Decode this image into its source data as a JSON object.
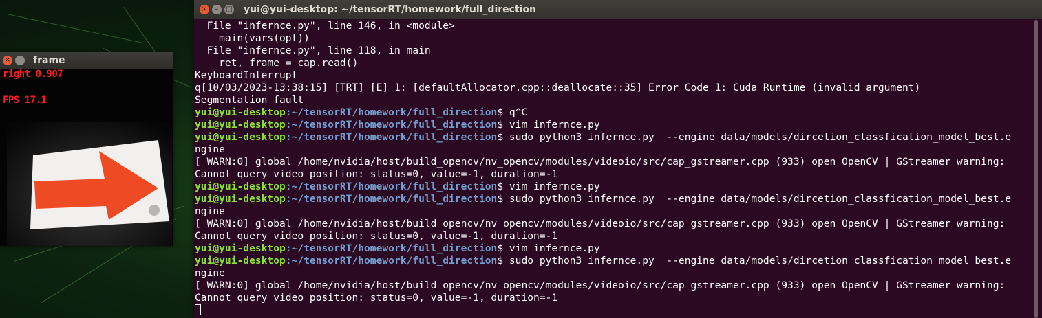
{
  "frame_window": {
    "title": "frame",
    "close_glyph": "×",
    "min_glyph": "–",
    "overlay_label": "right 0.907",
    "overlay_fps": "FPS 17.1",
    "arrow_color": "#ee4a24",
    "card_color": "#f2f0ee"
  },
  "terminal": {
    "title": "yui@yui-desktop: ~/tensorRT/homework/full_direction",
    "close_glyph": "×",
    "min_glyph": "–",
    "max_glyph": "□",
    "prompt_user": "yui@yui-desktop",
    "prompt_path": ":~/tensorRT/homework/full_direction",
    "lines": [
      {
        "type": "out",
        "text": "  File \"infernce.py\", line 146, in <module>"
      },
      {
        "type": "out",
        "text": "    main(vars(opt))"
      },
      {
        "type": "out",
        "text": "  File \"infernce.py\", line 118, in main"
      },
      {
        "type": "out",
        "text": "    ret, frame = cap.read()"
      },
      {
        "type": "out",
        "text": "KeyboardInterrupt"
      },
      {
        "type": "out",
        "text": "q[10/03/2023-13:38:15] [TRT] [E] 1: [defaultAllocator.cpp::deallocate::35] Error Code 1: Cuda Runtime (invalid argument)"
      },
      {
        "type": "out",
        "text": "Segmentation fault"
      },
      {
        "type": "prompt",
        "text": "$ q^C"
      },
      {
        "type": "prompt",
        "text": "$ vim infernce.py"
      },
      {
        "type": "prompt",
        "text": "$ sudo python3 infernce.py  --engine data/models/dircetion_classfication_model_best.e"
      },
      {
        "type": "out",
        "text": "ngine"
      },
      {
        "type": "out",
        "text": "[ WARN:0] global /home/nvidia/host/build_opencv/nv_opencv/modules/videoio/src/cap_gstreamer.cpp (933) open OpenCV | GStreamer warning:"
      },
      {
        "type": "out",
        "text": "Cannot query video position: status=0, value=-1, duration=-1"
      },
      {
        "type": "prompt",
        "text": "$ vim infernce.py"
      },
      {
        "type": "prompt",
        "text": "$ sudo python3 infernce.py  --engine data/models/dircetion_classfication_model_best.e"
      },
      {
        "type": "out",
        "text": "ngine"
      },
      {
        "type": "out",
        "text": "[ WARN:0] global /home/nvidia/host/build_opencv/nv_opencv/modules/videoio/src/cap_gstreamer.cpp (933) open OpenCV | GStreamer warning:"
      },
      {
        "type": "out",
        "text": "Cannot query video position: status=0, value=-1, duration=-1"
      },
      {
        "type": "prompt",
        "text": "$ vim infernce.py"
      },
      {
        "type": "prompt",
        "text": "$ sudo python3 infernce.py  --engine data/models/dircetion_classfication_model_best.e"
      },
      {
        "type": "out",
        "text": "ngine"
      },
      {
        "type": "out",
        "text": "[ WARN:0] global /home/nvidia/host/build_opencv/nv_opencv/modules/videoio/src/cap_gstreamer.cpp (933) open OpenCV | GStreamer warning:"
      },
      {
        "type": "out",
        "text": "Cannot query video position: status=0, value=-1, duration=-1"
      }
    ],
    "colors": {
      "background": "#2c0922",
      "prompt_user": "#8ae234",
      "prompt_path": "#729fcf",
      "text": "#ffffff"
    }
  }
}
